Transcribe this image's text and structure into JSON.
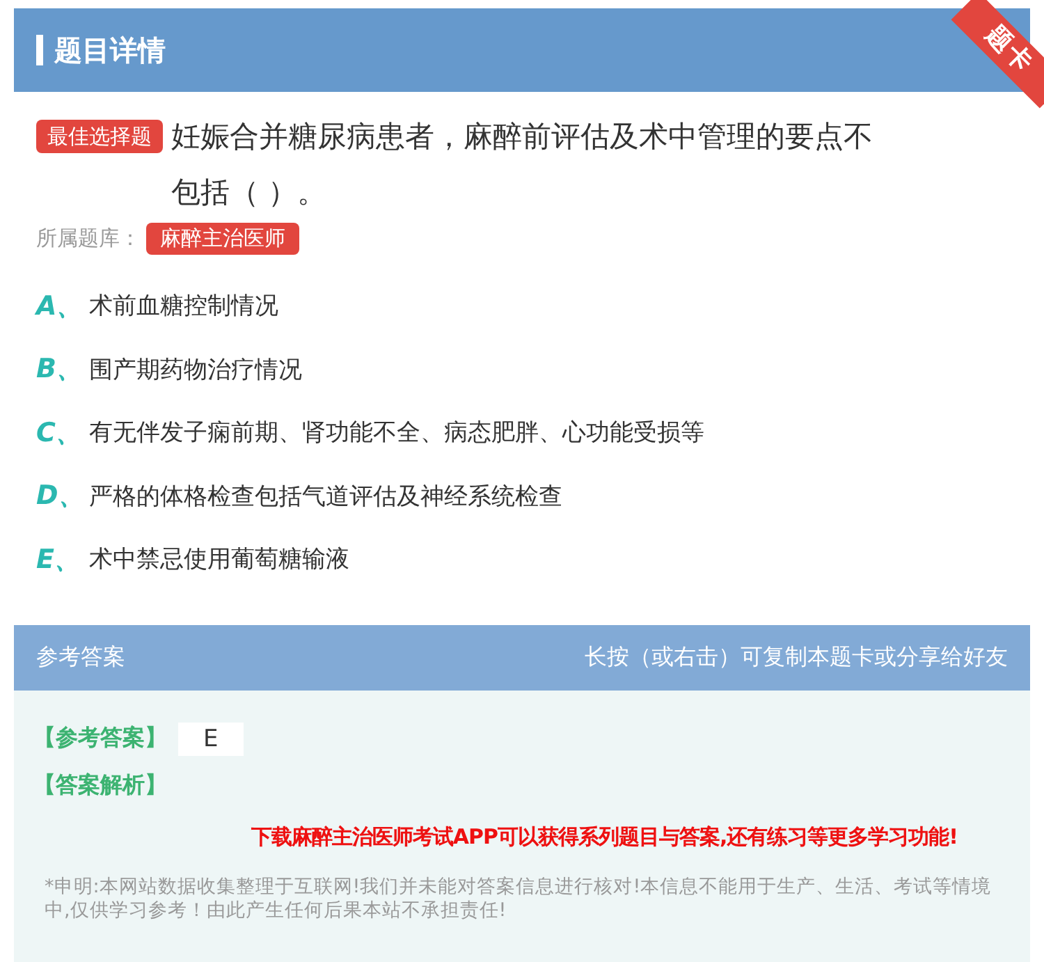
{
  "header": {
    "title": "题目详情",
    "ribbon": "题卡"
  },
  "question": {
    "type_badge": "最佳选择题",
    "text": "妊娠合并糖尿病患者，麻醉前评估及术中管理的要点不包括（ ）。",
    "bank_label": "所属题库：",
    "bank": "麻醉主治医师"
  },
  "options": [
    {
      "letter": "A、",
      "text": "术前血糖控制情况"
    },
    {
      "letter": "B、",
      "text": "围产期药物治疗情况"
    },
    {
      "letter": "C、",
      "text": "有无伴发子痫前期、肾功能不全、病态肥胖、心功能受损等"
    },
    {
      "letter": "D、",
      "text": "严格的体格检查包括气道评估及神经系统检查"
    },
    {
      "letter": "E、",
      "text": "术中禁忌使用葡萄糖输液"
    }
  ],
  "answer": {
    "title": "参考答案",
    "hint": "长按（或右击）可复制本题卡或分享给好友",
    "answer_label": "【参考答案】",
    "answer_value": "E",
    "analysis_label": "【答案解析】",
    "promo": "下载麻醉主治医师考试APP可以获得系列题目与答案,还有练习等更多学习功能!",
    "disclaimer": "*申明:本网站数据收集整理于互联网!我们并未能对答案信息进行核对!本信息不能用于生产、生活、考试等情境中,仅供学习参考！由此产生任何后果本站不承担责任!"
  }
}
